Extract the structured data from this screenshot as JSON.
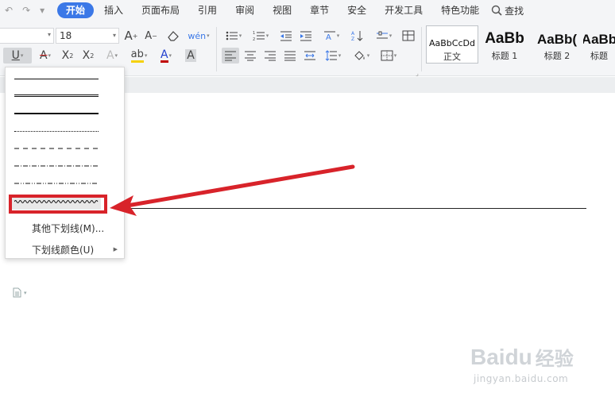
{
  "quick_access": {
    "undo_icon": "↶",
    "redo_icon": "↷",
    "more_icon": "▾"
  },
  "menu": {
    "tabs": [
      "开始",
      "插入",
      "页面布局",
      "引用",
      "审阅",
      "视图",
      "章节",
      "安全",
      "开发工具",
      "特色功能"
    ],
    "active_tab": "开始",
    "search_label": "查找"
  },
  "ribbon": {
    "font_size": "18",
    "styles": [
      {
        "preview": "AaBbCcDd",
        "name": "正文"
      },
      {
        "preview": "AaBb",
        "name": "标题 1"
      },
      {
        "preview": "AaBb(",
        "name": "标题 2"
      },
      {
        "preview": "AaBb",
        "name": "标题"
      }
    ]
  },
  "underline_menu": {
    "options": [
      "single",
      "double",
      "thick",
      "dotted",
      "dashed",
      "dash-dot",
      "dash-dot-dot",
      "wave"
    ],
    "highlighted": "wave",
    "other_label": "其他下划线(M)...",
    "color_label": "下划线颜色(U)"
  },
  "annotation": {
    "color": "#d8232a"
  },
  "watermark": {
    "brand": "Baidu",
    "cn": "经验",
    "url": "jingyan.baidu.com"
  },
  "colors": {
    "accent": "#3b78e7",
    "highlight_yellow": "#f5d10c",
    "font_red": "#c00000",
    "font_blue": "#1f3fcf"
  }
}
